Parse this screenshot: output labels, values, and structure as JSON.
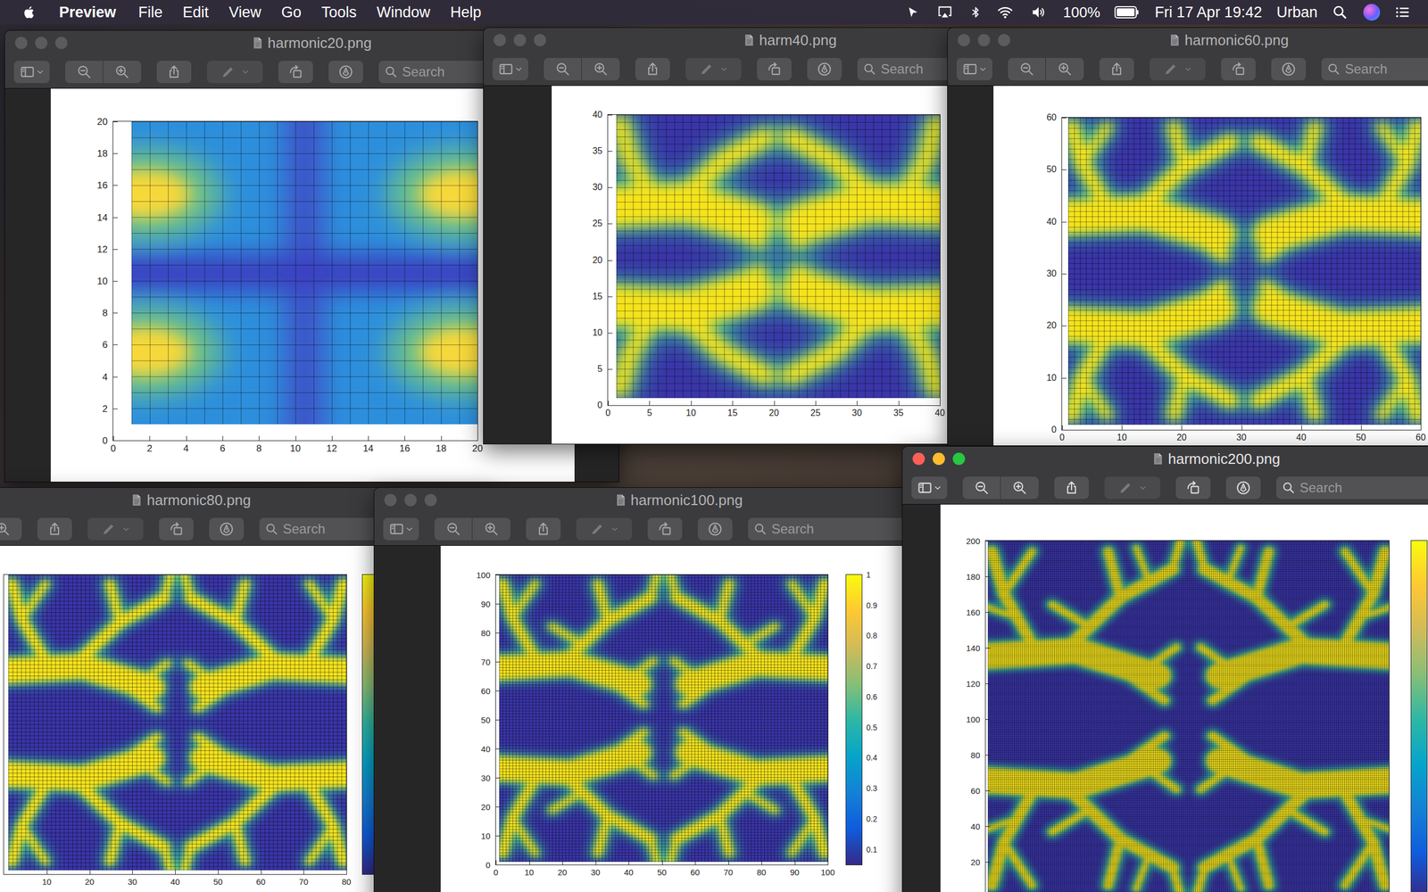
{
  "menu_bar": {
    "app": "Preview",
    "items": [
      "File",
      "Edit",
      "View",
      "Go",
      "Tools",
      "Window",
      "Help"
    ],
    "battery": "100%",
    "battery_level": 1,
    "clock": "Fri 17 Apr 19:42",
    "user": "Urban"
  },
  "windows": [
    {
      "title": "harmonic20.png",
      "active": false,
      "search": {
        "placeholder": "Search"
      },
      "figure": {
        "cells": 20,
        "x_ticks": [
          "0",
          "2",
          "4",
          "6",
          "8",
          "10",
          "12",
          "14",
          "16",
          "18",
          "20"
        ],
        "y_ticks": [
          "0",
          "2",
          "4",
          "6",
          "8",
          "10",
          "12",
          "14",
          "16",
          "18",
          "20"
        ],
        "colorbar": null
      }
    },
    {
      "title": "harm40.png",
      "active": false,
      "search": {
        "placeholder": "Search"
      },
      "figure": {
        "cells": 40,
        "x_ticks": [
          "0",
          "5",
          "10",
          "15",
          "20",
          "25",
          "30",
          "35",
          "40"
        ],
        "y_ticks": [
          "0",
          "5",
          "10",
          "15",
          "20",
          "25",
          "30",
          "35",
          "40"
        ],
        "colorbar": null
      }
    },
    {
      "title": "harmonic60.png",
      "active": false,
      "search": {
        "placeholder": "Search"
      },
      "figure": {
        "cells": 60,
        "x_ticks": [
          "0",
          "10",
          "20",
          "30",
          "40",
          "50",
          "60"
        ],
        "y_ticks": [
          "0",
          "10",
          "20",
          "30",
          "40",
          "50",
          "60"
        ],
        "colorbar": null
      }
    },
    {
      "title": "harmonic80.png",
      "active": false,
      "search": {
        "placeholder": "Search"
      },
      "figure": {
        "cells": 80,
        "x_ticks": [
          "10",
          "20",
          "30",
          "40",
          "50",
          "60",
          "70",
          "80"
        ],
        "y_ticks": [],
        "colorbar": {
          "ticks": []
        }
      }
    },
    {
      "title": "harmonic100.png",
      "active": false,
      "search": {
        "placeholder": "Search"
      },
      "figure": {
        "cells": 100,
        "x_ticks": [
          "0",
          "10",
          "20",
          "30",
          "40",
          "50",
          "60",
          "70",
          "80",
          "90",
          "100"
        ],
        "y_ticks": [
          "0",
          "10",
          "20",
          "30",
          "40",
          "50",
          "60",
          "70",
          "80",
          "90",
          "100"
        ],
        "colorbar": {
          "ticks": [
            "0.1",
            "0.2",
            "0.3",
            "0.4",
            "0.5",
            "0.6",
            "0.7",
            "0.8",
            "0.9",
            "1"
          ]
        }
      }
    },
    {
      "title": "harmonic200.png",
      "active": true,
      "search": {
        "placeholder": "Search"
      },
      "figure": {
        "cells": 200,
        "x_ticks": [],
        "y_ticks": [
          "20",
          "40",
          "60",
          "80",
          "100",
          "120",
          "140",
          "160",
          "180",
          "200"
        ],
        "colorbar": {
          "ticks": []
        }
      }
    }
  ]
}
